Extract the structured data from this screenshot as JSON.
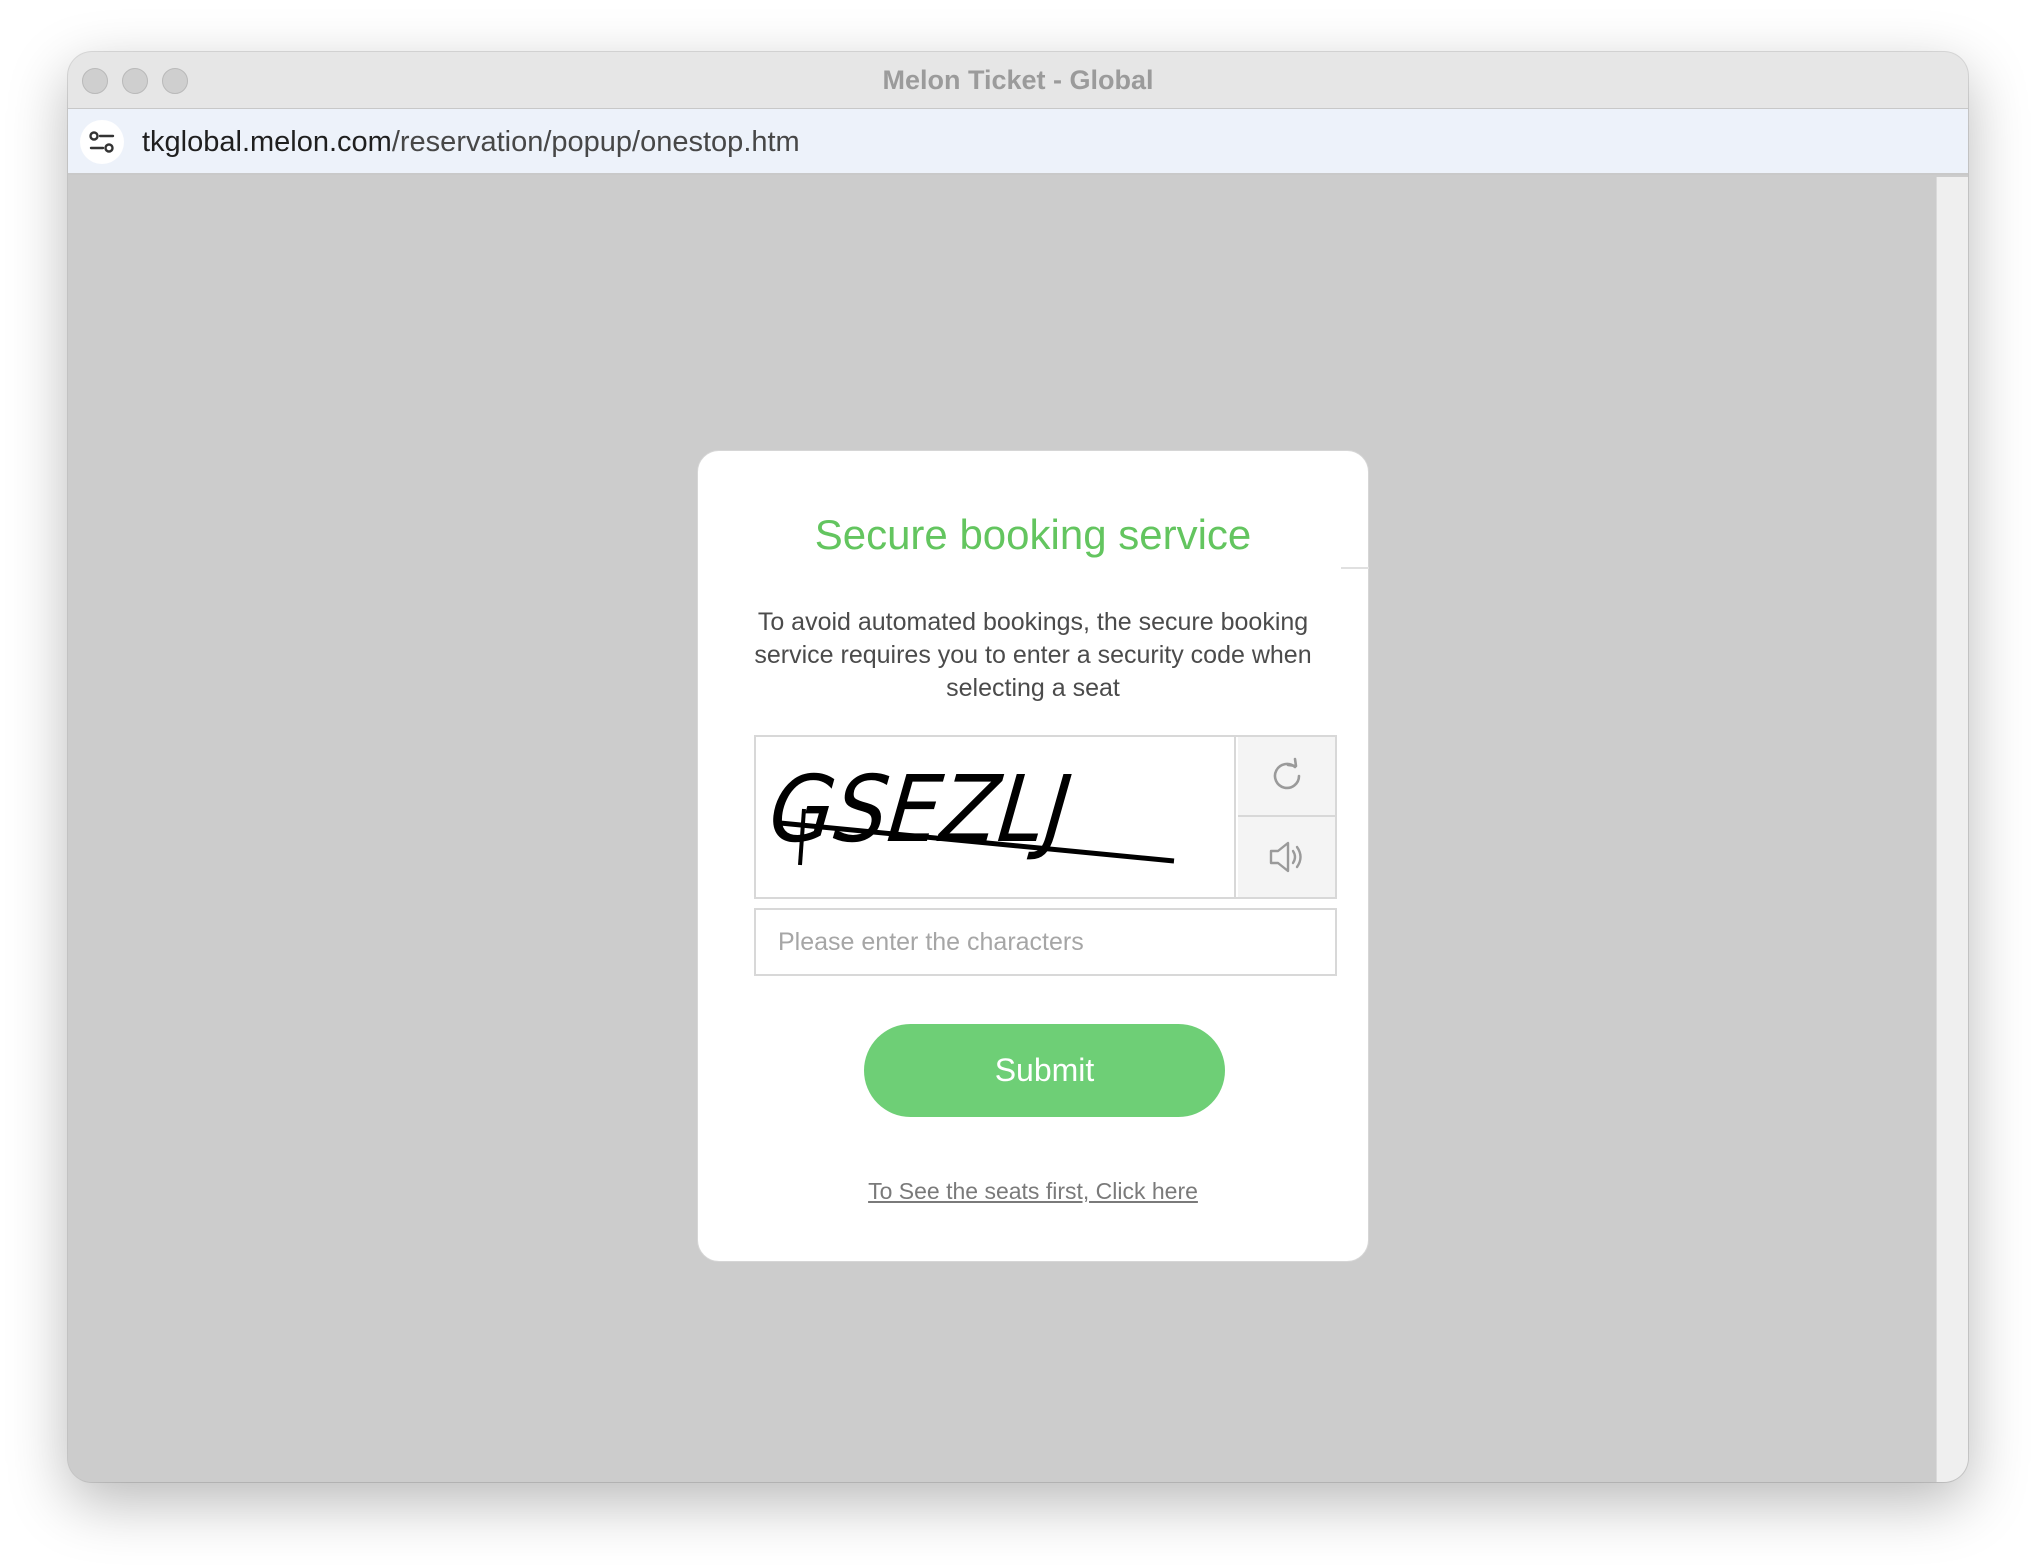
{
  "window": {
    "title": "Melon Ticket - Global"
  },
  "urlbar": {
    "host": "tkglobal.melon.com",
    "path": "/reservation/popup/onestop.htm",
    "settings_icon": "site-settings-icon"
  },
  "dialog": {
    "title": "Secure booking service",
    "description": "To avoid automated bookings, the secure booking service requires you to enter a security code when selecting a seat",
    "captcha": {
      "text": "GSEZLJ",
      "refresh_icon": "refresh-icon",
      "audio_icon": "speaker-icon"
    },
    "input_placeholder": "Please enter the characters",
    "submit_label": "Submit",
    "seats_link": "To See the seats first, Click here"
  },
  "colors": {
    "accent_green": "#63c55f",
    "button_green": "#6ecf76",
    "overlay_gray": "#cccccc"
  }
}
